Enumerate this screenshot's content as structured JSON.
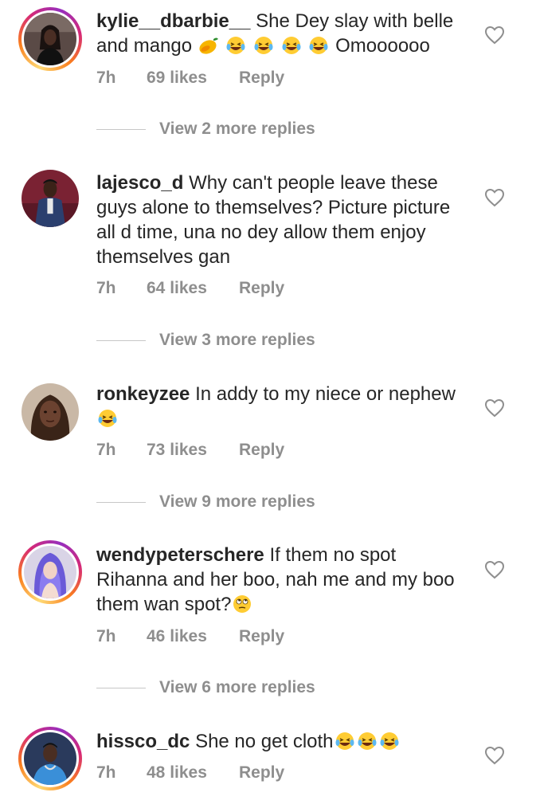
{
  "comments": [
    {
      "username": "kylie__dbarbie__",
      "text_before": "She Dey slay with belle and mango",
      "emojis": [
        "mango-emoji",
        "laughing-tears-emoji",
        "laughing-tears-emoji",
        "laughing-tears-emoji",
        "laughing-tears-emoji"
      ],
      "text_after": "Omoooooo",
      "time": "7h",
      "likes": "69 likes",
      "reply": "Reply",
      "view_replies": "View 2 more replies",
      "has_story_ring": true
    },
    {
      "username": "lajesco_d",
      "text_before": "Why can't people leave these guys alone to themselves? Picture picture all d time, una no dey allow them enjoy themselves gan",
      "emojis": [],
      "text_after": "",
      "time": "7h",
      "likes": "64 likes",
      "reply": "Reply",
      "view_replies": "View 3 more replies",
      "has_story_ring": false
    },
    {
      "username": "ronkeyzee",
      "text_before": "In addy to my niece or nephew",
      "emojis": [
        "laughing-tears-emoji"
      ],
      "text_after": "",
      "time": "7h",
      "likes": "73 likes",
      "reply": "Reply",
      "view_replies": "View 9 more replies",
      "has_story_ring": false
    },
    {
      "username": "wendypeterschere",
      "text_before": "If them no spot Rihanna and her boo, nah me and my boo them wan spot?",
      "emojis": [
        "eye-roll-emoji"
      ],
      "text_after": "",
      "time": "7h",
      "likes": "46 likes",
      "reply": "Reply",
      "view_replies": "View 6 more replies",
      "has_story_ring": true
    },
    {
      "username": "hissco_dc",
      "text_before": "She no get cloth",
      "emojis": [
        "laughing-tears-emoji",
        "laughing-tears-emoji",
        "laughing-tears-emoji"
      ],
      "text_after": "",
      "time": "7h",
      "likes": "48 likes",
      "reply": "Reply",
      "view_replies": "",
      "has_story_ring": true
    }
  ],
  "colors": {
    "text": "#262626",
    "muted": "#8e8e8e",
    "divider": "#c7c7c7"
  }
}
